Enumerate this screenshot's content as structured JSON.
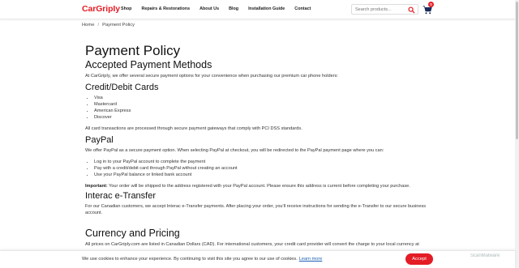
{
  "header": {
    "logo": "CarGripIy",
    "nav": [
      "Shop",
      "Repairs & Restorations",
      "About Us",
      "Blog",
      "Installation Guide",
      "Contact"
    ],
    "search_placeholder": "Search products...",
    "cart_count": "0"
  },
  "breadcrumb": {
    "home": "Home",
    "sep": "/",
    "current": "Payment Policy"
  },
  "main": {
    "title": "Payment Policy",
    "accepted_heading": "Accepted Payment Methods",
    "accepted_intro": "At CarGripIy, we offer several secure payment options for your convenience when purchasing our premium car phone holders:",
    "cards_heading": "Credit/Debit Cards",
    "cards": [
      "Visa",
      "Mastercard",
      "American Express",
      "Discover"
    ],
    "cards_note": "All card transactions are processed through secure payment gateways that comply with PCI DSS standards.",
    "paypal_heading": "PayPal",
    "paypal_intro": "We offer PayPal as a secure payment option. When selecting PayPal at checkout, you will be redirected to the PayPal payment page where you can:",
    "paypal_items": [
      "Log in to your PayPal account to complete the payment",
      "Pay with a credit/debit card through PayPal without creating an account",
      "Use your PayPal balance or linked bank account"
    ],
    "paypal_important_label": "Important:",
    "paypal_important_text": " Your order will be shipped to the address registered with your PayPal account. Please ensure this address is current before completing your purchase.",
    "interac_heading": "Interac e-Transfer",
    "interac_text": "For our Canadian customers, we accept Interac e-Transfer payments. After placing your order, you'll receive instructions for sending the e-Transfer to our secure business account.",
    "currency_heading": "Currency and Pricing",
    "currency_text": "All prices on CarGripIy.com are listed in Canadian Dollars (CAD). For international customers, your credit card provider will convert the charge to your local currency at"
  },
  "cookie": {
    "text": "We use cookies to enhance your experience. By continuing to visit this site you agree to our use of cookies.",
    "learn_more": "Learn more",
    "accept": "Accept"
  },
  "watermark": "ScanMalware"
}
